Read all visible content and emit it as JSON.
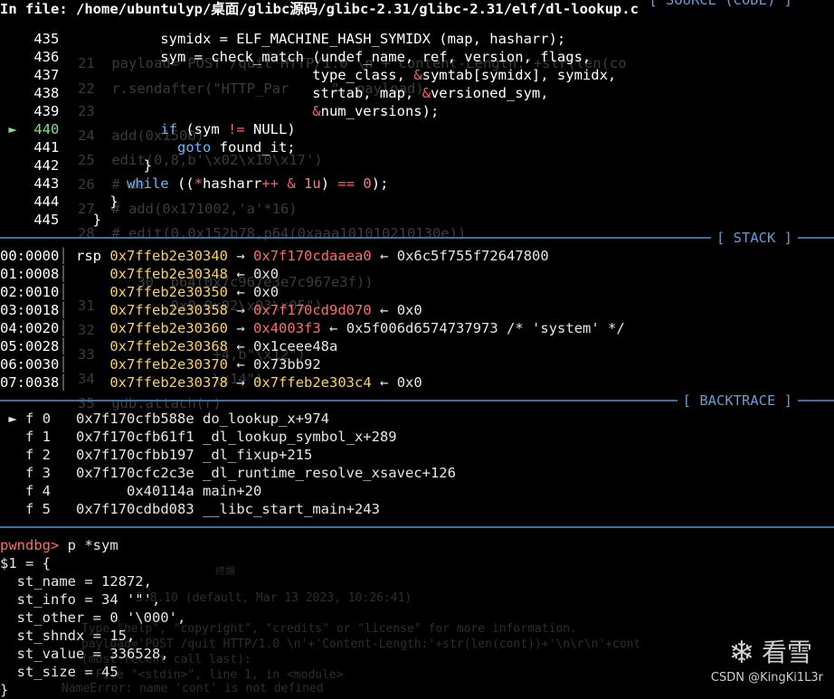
{
  "file": {
    "label": "In file: ",
    "path": "/home/ubuntulyp/桌面/glibc源码/glibc-2.31/glibc-2.31/elf/dl-lookup.c",
    "tag": "[ SOURCE (CODE) ]"
  },
  "source": {
    "lines": [
      {
        "no": "435",
        "code": "            symidx = ELF_MACHINE_HASH_SYMIDX (map, hasharr);"
      },
      {
        "no": "436",
        "code": "            sym = check_match (undef_name, ref, version, flags,"
      },
      {
        "no": "437",
        "code": "                              type_class, &symtab[symidx], symidx,"
      },
      {
        "no": "438",
        "code": "                              strtab, map, &versioned_sym,"
      },
      {
        "no": "439",
        "code": "                              &num_versions);"
      },
      {
        "no": "440",
        "code": "            if (sym != NULL)",
        "current": true
      },
      {
        "no": "441",
        "code": "              goto found_it;"
      },
      {
        "no": "442",
        "code": "          }"
      },
      {
        "no": "443",
        "code": "        while ((*hasharr++ & 1u) == 0);"
      },
      {
        "no": "444",
        "code": "      }"
      },
      {
        "no": "445",
        "code": "    }"
      }
    ],
    "current_marker": "►"
  },
  "stack": {
    "title": "[ STACK ]",
    "rows": [
      {
        "idx": "00:0000",
        "reg": "rsp",
        "addr": "0x7ffeb2e30340",
        "arrow1": "→",
        "v1": "0x7f170cdaaea0",
        "arrow2": "←",
        "v2": "0x6c5f755f72647800",
        "comment": ""
      },
      {
        "idx": "01:0008",
        "reg": "",
        "addr": "0x7ffeb2e30348",
        "arrow1": "←",
        "v1": "0x0",
        "arrow2": "",
        "v2": "",
        "comment": ""
      },
      {
        "idx": "02:0010",
        "reg": "",
        "addr": "0x7ffeb2e30350",
        "arrow1": "←",
        "v1": "0x0",
        "arrow2": "",
        "v2": "",
        "comment": ""
      },
      {
        "idx": "03:0018",
        "reg": "",
        "addr": "0x7ffeb2e30358",
        "arrow1": "→",
        "v1": "0x7f170cd9d070",
        "arrow2": "←",
        "v2": "0x0",
        "comment": ""
      },
      {
        "idx": "04:0020",
        "reg": "",
        "addr": "0x7ffeb2e30360",
        "arrow1": "→",
        "v1": "0x4003f3",
        "arrow2": "←",
        "v2": "0x5f006d6574737973",
        "comment": "/* 'system' */"
      },
      {
        "idx": "05:0028",
        "reg": "",
        "addr": "0x7ffeb2e30368",
        "arrow1": "←",
        "v1": "0x1ceee48a",
        "arrow2": "",
        "v2": "",
        "comment": ""
      },
      {
        "idx": "06:0030",
        "reg": "",
        "addr": "0x7ffeb2e30370",
        "arrow1": "←",
        "v1": "0x73bb92",
        "arrow2": "",
        "v2": "",
        "comment": ""
      },
      {
        "idx": "07:0038",
        "reg": "",
        "addr": "0x7ffeb2e30378",
        "arrow1": "→",
        "v1": "0x7ffeb2e303c4",
        "arrow2": "←",
        "v2": "0x0",
        "comment": ""
      }
    ]
  },
  "backtrace": {
    "title": "[ BACKTRACE ]",
    "marker": "►",
    "frames": [
      {
        "f": "f 0",
        "addr": "0x7f170cfb588e",
        "sym": "do_lookup_x+974"
      },
      {
        "f": "f 1",
        "addr": "0x7f170cfb61f1",
        "sym": "_dl_lookup_symbol_x+289"
      },
      {
        "f": "f 2",
        "addr": "0x7f170cfbb197",
        "sym": "_dl_fixup+215"
      },
      {
        "f": "f 3",
        "addr": "0x7f170cfc2c3e",
        "sym": "_dl_runtime_resolve_xsavec+126"
      },
      {
        "f": "f 4",
        "addr": "0x40114a",
        "sym": "main+20"
      },
      {
        "f": "f 5",
        "addr": "0x7f170cdbd083",
        "sym": "__libc_start_main+243"
      }
    ]
  },
  "console": {
    "prompt": "pwndbg>",
    "command": " p *sym",
    "output": [
      "$1 = {",
      "  st_name = 12872,",
      "  st_info = 34 '\"',",
      "  st_other = 0 '\\000',",
      "  st_shndx = 15,",
      "  st_value = 336528,",
      "  st_size = 45",
      "}"
    ]
  },
  "background_ghost": {
    "lines": [
      {
        "no": "21",
        "text": "payload='POST /quit HTTP/1.0 \\n'+'Content-Length:'+str(len(co"
      },
      {
        "no": "22",
        "text": "r.sendafter(\"HTTP_Par     \", payload)"
      },
      {
        "no": "23",
        "text": ""
      },
      {
        "no": "24",
        "text": "add(0x1500)"
      },
      {
        "no": "25",
        "text": "edit(0,8,b'\\x02\\x10\\x17')"
      },
      {
        "no": "26",
        "text": "# de"
      },
      {
        "no": "27",
        "text": "# add(0x171002,'a'*16)"
      },
      {
        "no": "28",
        "text": "# edit(0,0x152b78,p64(0xaaa101010210130e))"
      },
      {
        "no": "30",
        "text": "       30  p64(0x7c967e3e7c967e3f))"
      },
      {
        "no": "31",
        "text": "         0x0 0x02\\x03\\x05\")"
      },
      {
        "no": "32",
        "text": ""
      },
      {
        "no": "33",
        "text": "              +4,b\"\\x12\")"
      },
      {
        "no": "34",
        "text": "              \\x14\")"
      },
      {
        "no": "35",
        "text": "gdb.attach(r)"
      }
    ],
    "terminal": [
      "3.8.10 (default, Mar 13 2023, 10:26:41)",
      "Type \"help\", \"copyright\", \"credits\" or \"license\" for more information.",
      "payload='POST /quit HTTP/1.0 \\n'+'Content-Length:'+str(len(cont))+'\\n\\r\\n'+cont",
      "(most recent call last):",
      "  File \"<stdin>\", line 1, in <module>",
      "NameError: name 'cont' is not defined"
    ],
    "tabs": [
      "终端"
    ]
  },
  "watermark": {
    "brand": "看雪",
    "credit": "CSDN @KingKi1L3r"
  }
}
